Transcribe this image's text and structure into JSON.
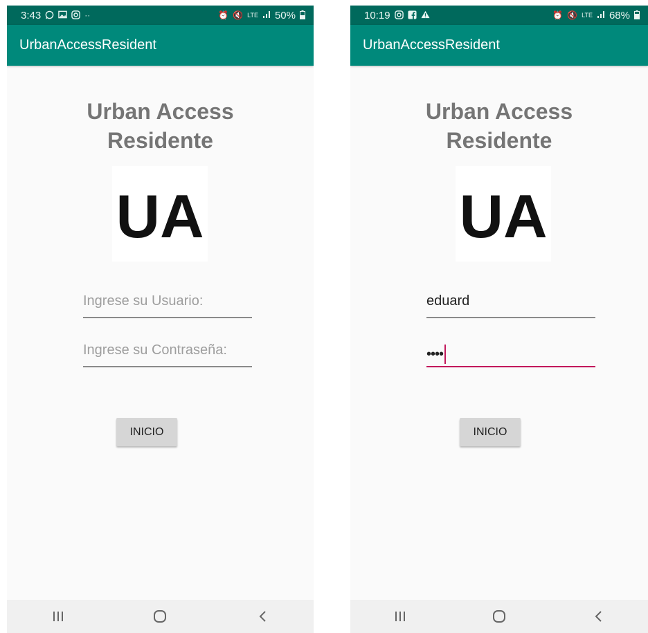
{
  "screens": [
    {
      "status_bar": {
        "time": "3:43",
        "left_icons": [
          "whatsapp-icon",
          "gallery-icon",
          "instagram-icon",
          "more-dots-icon"
        ],
        "battery": "50%",
        "network": "LTE"
      },
      "app_bar": {
        "title": "UrbanAccessResident"
      },
      "title_line1": "Urban Access",
      "title_line2": "Residente",
      "logo_text": "UA",
      "username": {
        "value": "",
        "placeholder": "Ingrese su Usuario:"
      },
      "password": {
        "value": "",
        "placeholder": "Ingrese su Contraseña:"
      },
      "login_button": "INICIO",
      "nav": {
        "recents": "recents-icon",
        "home": "home-icon",
        "back": "back-icon"
      }
    },
    {
      "status_bar": {
        "time": "10:19",
        "left_icons": [
          "instagram-icon",
          "facebook-icon",
          "warning-icon"
        ],
        "battery": "68%",
        "network": "LTE"
      },
      "app_bar": {
        "title": "UrbanAccessResident"
      },
      "title_line1": "Urban Access",
      "title_line2": "Residente",
      "logo_text": "UA",
      "username": {
        "value": "eduard",
        "placeholder": "Ingrese su Usuario:"
      },
      "password": {
        "value": "••••",
        "placeholder": "Ingrese su Contraseña:"
      },
      "login_button": "INICIO",
      "nav": {
        "recents": "recents-icon",
        "home": "home-icon",
        "back": "back-icon"
      }
    }
  ],
  "colors": {
    "status_bar": "#00695c",
    "app_bar": "#00897b",
    "focus_accent": "#c2185b",
    "title_text": "#757575"
  }
}
